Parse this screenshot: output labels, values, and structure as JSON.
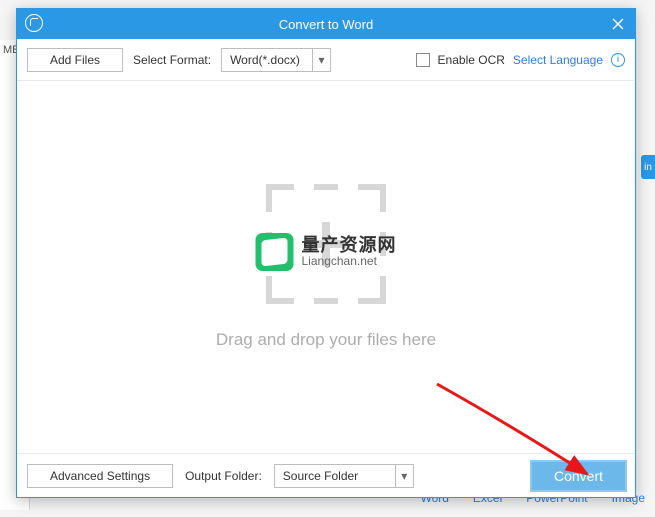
{
  "background": {
    "sidebar_fragment": "ME",
    "right_ribbon": "in",
    "tabs": [
      "Word",
      "Excel",
      "PowerPoint",
      "Image"
    ]
  },
  "dialog": {
    "title": "Convert to Word",
    "toolbar": {
      "add_files": "Add Files",
      "select_format_label": "Select Format:",
      "select_format_value": "Word(*.docx)",
      "enable_ocr": "Enable OCR",
      "select_language": "Select Language"
    },
    "drop": {
      "hint": "Drag and drop your files here",
      "watermark_cn": "量产资源网",
      "watermark_en": "Liangchan.net"
    },
    "footer": {
      "advanced_settings": "Advanced Settings",
      "output_folder_label": "Output Folder:",
      "output_folder_value": "Source Folder",
      "convert": "Convert"
    }
  }
}
